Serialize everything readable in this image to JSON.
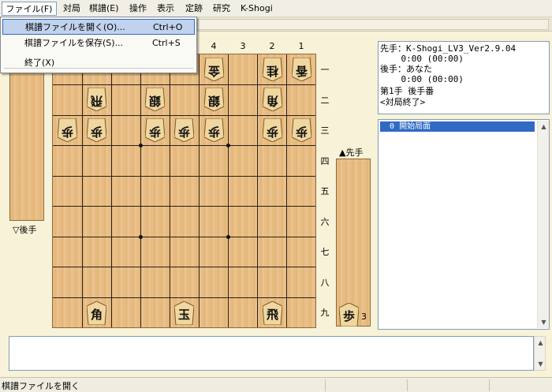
{
  "menu": {
    "file": "ファイル(F)",
    "match": "対局",
    "kifu": "棋譜(E)",
    "operation": "操作",
    "view": "表示",
    "joseki": "定跡",
    "study": "研究",
    "app": "K-Shogi"
  },
  "file_menu": {
    "open_label": "棋譜ファイルを開く(O)...",
    "open_shortcut": "Ctrl+O",
    "save_label": "棋譜ファイルを保存(S)...",
    "save_shortcut": "Ctrl+S",
    "exit_label": "終了(X)"
  },
  "board": {
    "files": [
      "4",
      "3",
      "2",
      "1"
    ],
    "ranks": [
      "一",
      "二",
      "三",
      "四",
      "五",
      "六",
      "七",
      "八",
      "九"
    ],
    "pieces": {
      "r1c6": "金",
      "r1c8": "桂",
      "r1c9": "香",
      "r2c2": "飛",
      "r2c4": "銀",
      "r2c6": "銀",
      "r2c8": "角",
      "r3c1": "歩",
      "r3c2": "歩",
      "r3c4": "歩",
      "r3c5": "歩",
      "r3c6": "歩",
      "r3c8": "歩",
      "r3c9": "歩",
      "r9c2": "角",
      "r9c5": "玉",
      "r9c8": "飛"
    }
  },
  "komadai": {
    "gote_label": "▽後手",
    "sente_label": "▲先手",
    "sente_piece": "歩",
    "sente_count": "3"
  },
  "info": {
    "line1": "先手：K-Shogi_LV3_Ver2.9.04",
    "line2": "    0:00 (00:00)",
    "line3": "後手：あなた",
    "line4": "    0:00 (00:00)",
    "line5": "第1手 後手番",
    "line6": "<対局終了>"
  },
  "kifu": {
    "selected": "  0 開始局面"
  },
  "scroll": {
    "up": "▲",
    "down": "▼"
  },
  "status": {
    "text": "棋譜ファイルを開く"
  },
  "colors": {
    "board_wood": "#e9bf86",
    "selection": "#316ac5",
    "background": "#f8f2d8"
  }
}
